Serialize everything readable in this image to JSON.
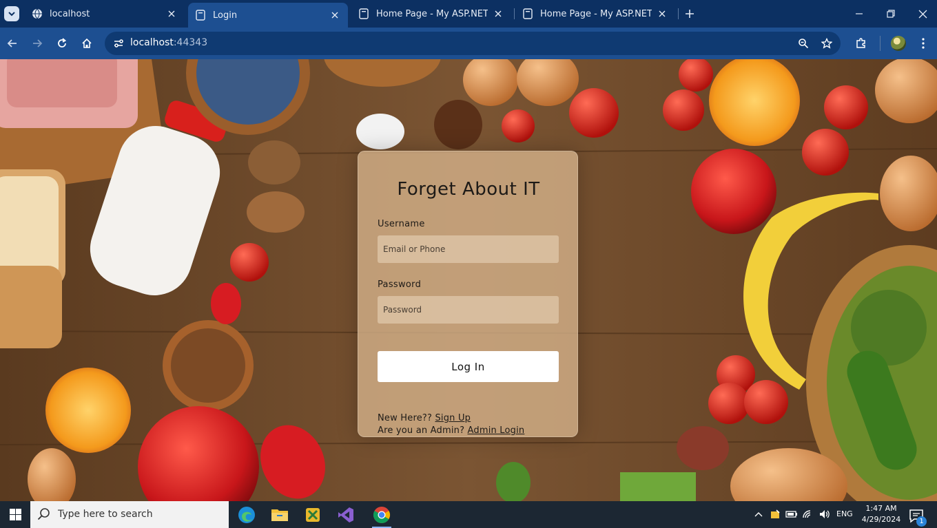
{
  "browser": {
    "tabs": [
      {
        "title": "localhost",
        "favicon": "globe-icon",
        "active": false
      },
      {
        "title": "Login",
        "favicon": "page-icon",
        "active": true
      },
      {
        "title": "Home Page - My ASP.NET Appl",
        "favicon": "page-icon",
        "active": false
      },
      {
        "title": "Home Page - My ASP.NET Appl",
        "favicon": "page-icon",
        "active": false
      }
    ],
    "url_host": "localhost",
    "url_port": ":44343"
  },
  "login": {
    "title": "Forget About IT",
    "username_label": "Username",
    "username_placeholder": "Email or Phone",
    "password_label": "Password",
    "password_placeholder": "Password",
    "login_button": "Log In",
    "new_here_text": "New Here??",
    "signup_link": "Sign Up",
    "admin_text": "Are you an Admin?",
    "admin_link": "Admin Login"
  },
  "taskbar": {
    "search_placeholder": "Type here to search",
    "language": "ENG",
    "time": "1:47 AM",
    "date": "4/29/2024",
    "notification_count": "1"
  },
  "colors": {
    "tab_strip": "#0c3062",
    "toolbar": "#1d4f91",
    "card": "#d6b48c",
    "taskbar": "#1c2733"
  }
}
